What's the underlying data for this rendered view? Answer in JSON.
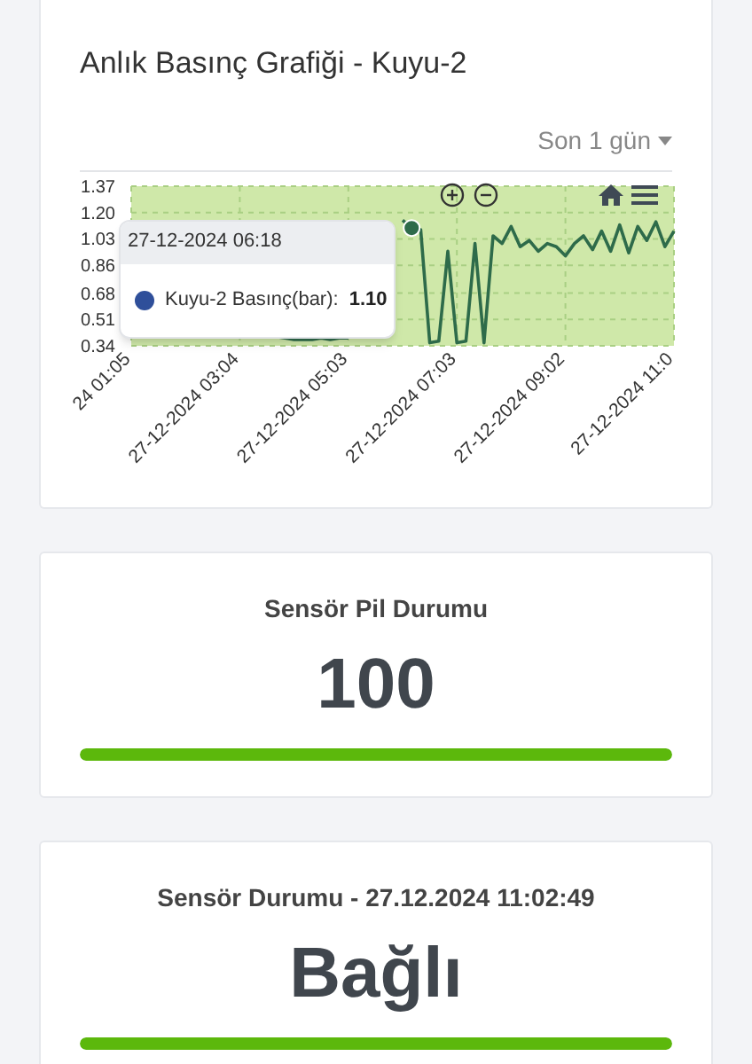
{
  "chart_card": {
    "title": "Anlık Basınç Grafiği - Kuyu-2",
    "range": "Son 1 gün",
    "chart_data": {
      "type": "line",
      "categories": [
        "24 01:05",
        null,
        null,
        null,
        null,
        null,
        null,
        null,
        null,
        null,
        null,
        null,
        "27-12-2024 03:04",
        null,
        null,
        null,
        null,
        null,
        null,
        null,
        null,
        null,
        null,
        null,
        "27-12-2024 05:03",
        null,
        null,
        null,
        null,
        null,
        null,
        null,
        null,
        null,
        null,
        null,
        "27-12-2024 07:03",
        null,
        null,
        null,
        null,
        null,
        null,
        null,
        null,
        null,
        null,
        null,
        "27-12-2024 09:02",
        null,
        null,
        null,
        null,
        null,
        null,
        null,
        null,
        null,
        null,
        null,
        "27-12-2024 11:0"
      ],
      "series": [
        {
          "color": "#2e6b4a",
          "values": [
            null,
            null,
            null,
            null,
            null,
            null,
            null,
            null,
            null,
            null,
            null,
            null,
            null,
            null,
            null,
            null,
            0.4,
            0.39,
            0.38,
            0.38,
            0.38,
            0.39,
            0.38,
            0.39,
            0.39,
            null,
            null,
            null,
            null,
            null,
            1.15,
            1.1,
            1.09,
            0.36,
            0.37,
            0.95,
            0.36,
            0.37,
            1.0,
            0.36,
            1.05,
            1.0,
            1.11,
            0.98,
            1.02,
            0.95,
            1.0,
            0.98,
            0.92,
            1.0,
            1.05,
            0.96,
            1.08,
            0.95,
            1.12,
            0.94,
            1.11,
            1.02,
            1.14,
            0.98,
            1.08
          ]
        }
      ],
      "grid": true,
      "ylim": [
        0.34,
        1.37
      ],
      "yticks": [
        {
          "value": 1.37,
          "label": "1.37"
        },
        {
          "value": 1.2,
          "label": "1.20"
        },
        {
          "value": 1.03,
          "label": "1.03"
        },
        {
          "value": 0.86,
          "label": "0.86"
        },
        {
          "value": 0.68,
          "label": "0.68"
        },
        {
          "value": 0.51,
          "label": "0.51"
        },
        {
          "value": 0.34,
          "label": "0.34"
        }
      ]
    },
    "tooltip": {
      "title": "27-12-2024 06:18",
      "label": "Kuyu-2 Basınç(bar):",
      "value": "1.10",
      "color": "#2f4f9a"
    }
  },
  "cards": [
    {
      "title": "Sensör Pil Durumu",
      "value": "100",
      "level": 1
    },
    {
      "title": "Sensör Durumu - 27.12.2024 11:02:49",
      "value": "Bağlı",
      "level": 1
    }
  ]
}
